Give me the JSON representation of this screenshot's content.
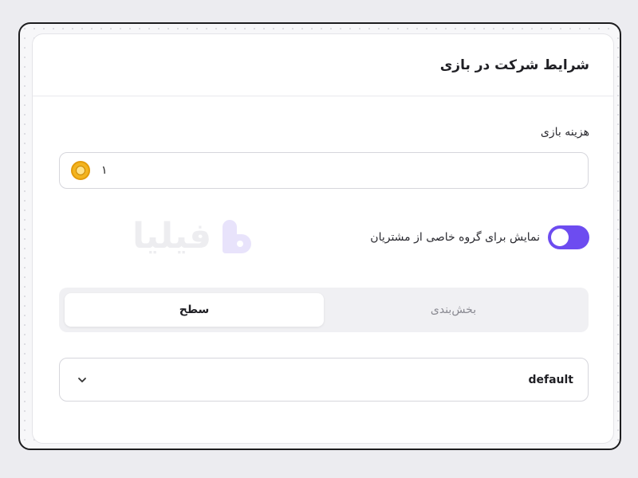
{
  "card": {
    "title": "شرایط شرکت در بازی"
  },
  "fee": {
    "label": "هزینه بازی",
    "value": "۱",
    "icon": "coin-icon"
  },
  "customer_group": {
    "label": "نمایش برای گروه خاصی از مشتریان",
    "enabled": true,
    "toggle_color": "#6d4cf0"
  },
  "watermark": {
    "text": "فیلیا"
  },
  "segment": {
    "tabs": [
      {
        "label": "سطح",
        "active": true
      },
      {
        "label": "بخش‌بندی",
        "active": false
      }
    ]
  },
  "level_select": {
    "value": "default",
    "icon": "chevron-down-icon"
  }
}
